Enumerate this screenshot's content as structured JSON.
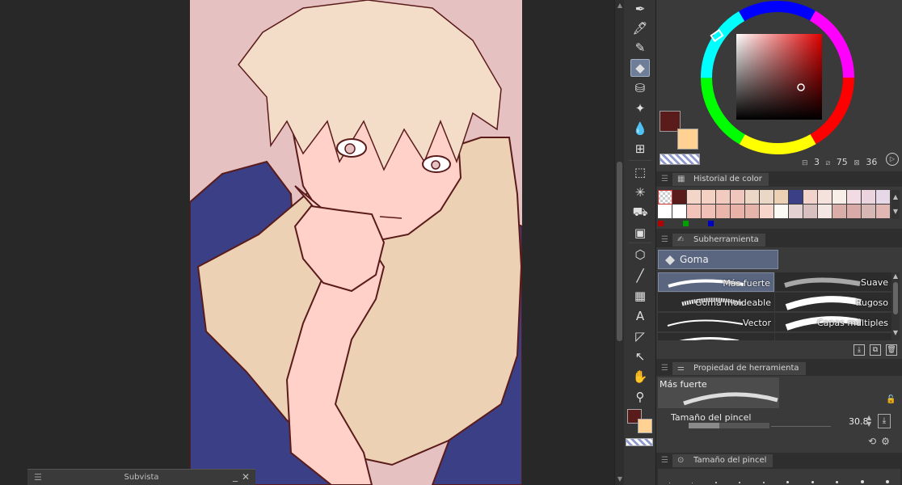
{
  "subview": {
    "title": "Subvista"
  },
  "colors": {
    "main": "#5a1b1b",
    "sub": "#ffd193",
    "readout": {
      "a": "3",
      "b": "75",
      "c": "36"
    }
  },
  "color_history": {
    "tab_label": "Historial de color",
    "row1": [
      "checker",
      "#5a1b1b",
      "#f4d6c8",
      "#f5d1c3",
      "#f2cbc0",
      "#f0c7bd",
      "#ecd6c6",
      "#ead7c5",
      "#ecd1b4",
      "#3a3f86",
      "#f2d3cb",
      "#f6e2dd",
      "#f8efe8",
      "#f2dbe3",
      "#ebd4de",
      "#e6d8e7"
    ],
    "row2": [
      "#ffffff",
      "#ffffff",
      "#f3c2b8",
      "#f0c0b6",
      "#eab5ab",
      "#e8b2a8",
      "#e5b4ab",
      "#f6d5ca",
      "#fbfaf5",
      "#e2d0d3",
      "#d9c0c0",
      "#f4e7e3",
      "#d9aea8",
      "#d8aaa8",
      "#d5b7b3",
      "#e0b7b3"
    ],
    "primaries": [
      "#b30000",
      "#00a000",
      "#0000c0"
    ]
  },
  "subtool": {
    "tab_label": "Subherramienta",
    "group": "Goma",
    "brushes": [
      "Más fuerte",
      "Suave",
      "Goma moldeable",
      "Rugoso",
      "Vector",
      "Capas múltiples"
    ]
  },
  "tool_property": {
    "tab_label": "Propiedad de herramienta",
    "preset": "Más fuerte",
    "brush_size_label": "Tamaño del pincel",
    "brush_size_value": "30.8",
    "brush_size_fill": 0.38
  },
  "brush_size_palette": {
    "tab_label": "Tamaño del pincel"
  },
  "tools": [
    "pen-icon",
    "marker-icon",
    "pencil-icon",
    "eraser-icon",
    "blend-icon",
    "decoration-icon",
    "ink-drop-icon",
    "perspective-grid-icon",
    "lasso-select-icon",
    "magic-wand-icon",
    "fill-icon",
    "gradient-icon",
    "object-select-icon",
    "line-icon",
    "pattern-icon",
    "text-icon",
    "frame-icon",
    "correction-line-icon",
    "hand-icon",
    "eyedropper-icon"
  ]
}
